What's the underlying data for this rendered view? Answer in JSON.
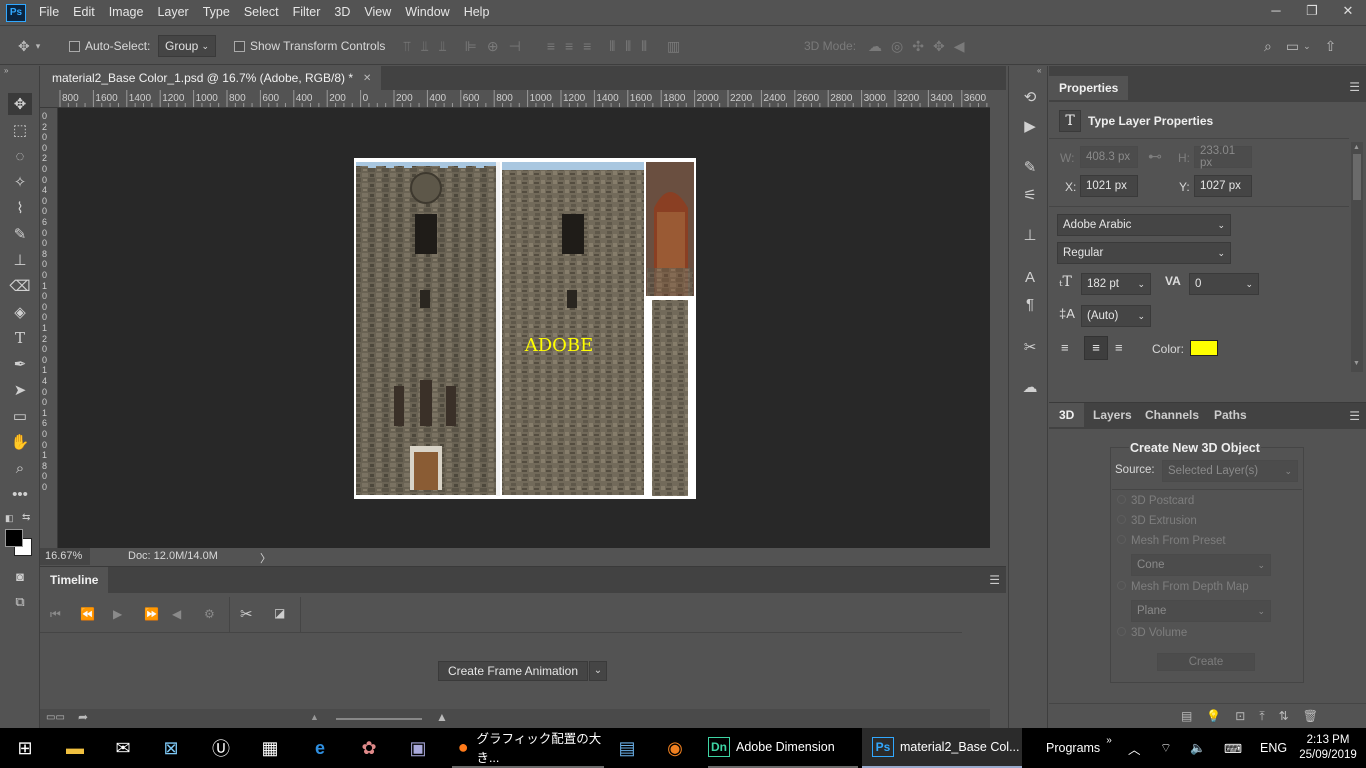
{
  "app": {
    "logo": "Ps"
  },
  "menu": [
    "File",
    "Edit",
    "Image",
    "Layer",
    "Type",
    "Select",
    "Filter",
    "3D",
    "View",
    "Window",
    "Help"
  ],
  "window_controls": {
    "minimize": "─",
    "restore": "❐",
    "close": "✕"
  },
  "options": {
    "auto_select_label": "Auto-Select:",
    "group_value": "Group",
    "transform_label": "Show Transform Controls",
    "mode_label": "3D Mode:"
  },
  "document": {
    "tab_title": "material2_Base Color_1.psd @ 16.7% (Adobe, RGB/8) *",
    "tab_close": "✕",
    "canvas_text": "ADOBE",
    "zoom": "16.67%",
    "doc_info": "Doc: 12.0M/14.0M",
    "status_arrow": "〉"
  },
  "ruler_top": [
    "800",
    "1600",
    "1400",
    "1200",
    "1000",
    "800",
    "600",
    "400",
    "200",
    "0",
    "200",
    "400",
    "600",
    "800",
    "1000",
    "1200",
    "1400",
    "1600",
    "1800",
    "2000",
    "2200",
    "2400",
    "2600",
    "2800",
    "3000",
    "3200",
    "3400",
    "3600"
  ],
  "ruler_left": [
    "0",
    "2",
    "0",
    "0",
    "2",
    "0",
    "0",
    "4",
    "0",
    "0",
    "6",
    "0",
    "0",
    "8",
    "0",
    "0",
    "1",
    "0",
    "0",
    "0",
    "1",
    "2",
    "0",
    "0",
    "1",
    "4",
    "0",
    "0",
    "1",
    "6",
    "0",
    "0",
    "1",
    "8",
    "0",
    "0"
  ],
  "timeline": {
    "title": "Timeline",
    "create_button": "Create Frame Animation"
  },
  "properties": {
    "title": "Properties",
    "subtitle": "Type Layer Properties",
    "w_label": "W:",
    "w_value": "408.3 px",
    "h_label": "H:",
    "h_value": "233.01 px",
    "x_label": "X:",
    "x_value": "1021 px",
    "y_label": "Y:",
    "y_value": "1027 px",
    "font_family": "Adobe Arabic",
    "font_style": "Regular",
    "font_size": "182 pt",
    "tracking": "0",
    "leading": "(Auto)",
    "color_label": "Color:",
    "text_color": "#ffff00"
  },
  "panel3d": {
    "tabs": [
      "3D",
      "Layers",
      "Channels",
      "Paths"
    ],
    "heading": "Create New 3D Object",
    "source_label": "Source:",
    "source_value": "Selected Layer(s)",
    "opt_postcard": "3D Postcard",
    "opt_extrusion": "3D Extrusion",
    "opt_preset": "Mesh From Preset",
    "preset_value": "Cone",
    "opt_depth": "Mesh From Depth Map",
    "depth_value": "Plane",
    "opt_volume": "3D Volume",
    "create_button": "Create"
  },
  "taskbar": {
    "firefox_title": "グラフィック配置の大き...",
    "dimension_title": "Adobe Dimension",
    "ps_title": "material2_Base Col...",
    "programs": "Programs",
    "lang": "ENG",
    "time": "2:13 PM",
    "date": "25/09/2019"
  }
}
